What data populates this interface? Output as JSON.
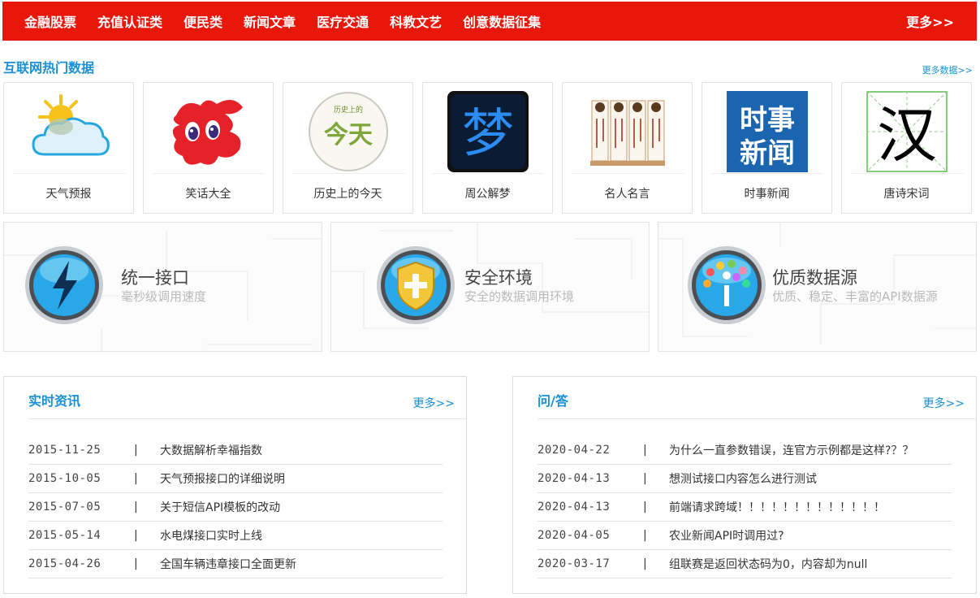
{
  "nav": {
    "items": [
      "金融股票",
      "充值认证类",
      "便民类",
      "新闻文章",
      "医疗交通",
      "科教文艺",
      "创意数据征集"
    ],
    "more": "更多>>"
  },
  "hot": {
    "title": "互联网热门数据",
    "more": "更多数据>>",
    "cards": [
      {
        "label": "天气预报",
        "icon": "weather-icon"
      },
      {
        "label": "笑话大全",
        "icon": "joke-icon"
      },
      {
        "label": "历史上的今天",
        "icon": "history-today-icon",
        "badge_top": "历史上的",
        "badge_main": "今天"
      },
      {
        "label": "周公解梦",
        "icon": "dream-icon",
        "glyph": "梦"
      },
      {
        "label": "名人名言",
        "icon": "quotes-scroll-icon"
      },
      {
        "label": "时事新闻",
        "icon": "news-icon",
        "glyph_text": "时事新闻"
      },
      {
        "label": "唐诗宋词",
        "icon": "poetry-icon",
        "glyph": "汉"
      }
    ]
  },
  "features": [
    {
      "title": "统一接口",
      "subtitle": "毫秒级调用速度",
      "icon": "lightning-orb-icon"
    },
    {
      "title": "安全环境",
      "subtitle": "安全的数据调用环境",
      "icon": "shield-orb-icon"
    },
    {
      "title": "优质数据源",
      "subtitle": "优质、稳定、丰富的API数据源",
      "icon": "data-tree-orb-icon"
    }
  ],
  "news": {
    "title": "实时资讯",
    "more": "更多>>",
    "rows": [
      {
        "date": "2015-11-25",
        "sep": "|",
        "text": "大数据解析幸福指数"
      },
      {
        "date": "2015-10-05",
        "sep": "|",
        "text": "天气预报接口的详细说明"
      },
      {
        "date": "2015-07-05",
        "sep": "|",
        "text": "关于短信API模板的改动"
      },
      {
        "date": "2015-05-14",
        "sep": "|",
        "text": "水电煤接口实时上线"
      },
      {
        "date": "2015-04-26",
        "sep": "|",
        "text": "全国车辆违章接口全面更新"
      }
    ]
  },
  "qa": {
    "title": "问/答",
    "more": "更多>>",
    "rows": [
      {
        "date": "2020-04-22",
        "sep": "|",
        "text": "为什么一直参数错误，连官方示例都是这样?？？"
      },
      {
        "date": "2020-04-13",
        "sep": "|",
        "text": "想测试接口内容怎么进行测试"
      },
      {
        "date": "2020-04-13",
        "sep": "|",
        "text": "前端请求跨域！！！！！！！！！！！！！"
      },
      {
        "date": "2020-04-05",
        "sep": "|",
        "text": "农业新闻API时调用过?"
      },
      {
        "date": "2020-03-17",
        "sep": "|",
        "text": "组联赛是返回状态码为0，内容却为null"
      }
    ]
  },
  "colors": {
    "nav_bg": "#e8170a",
    "accent": "#1a8fd6"
  }
}
